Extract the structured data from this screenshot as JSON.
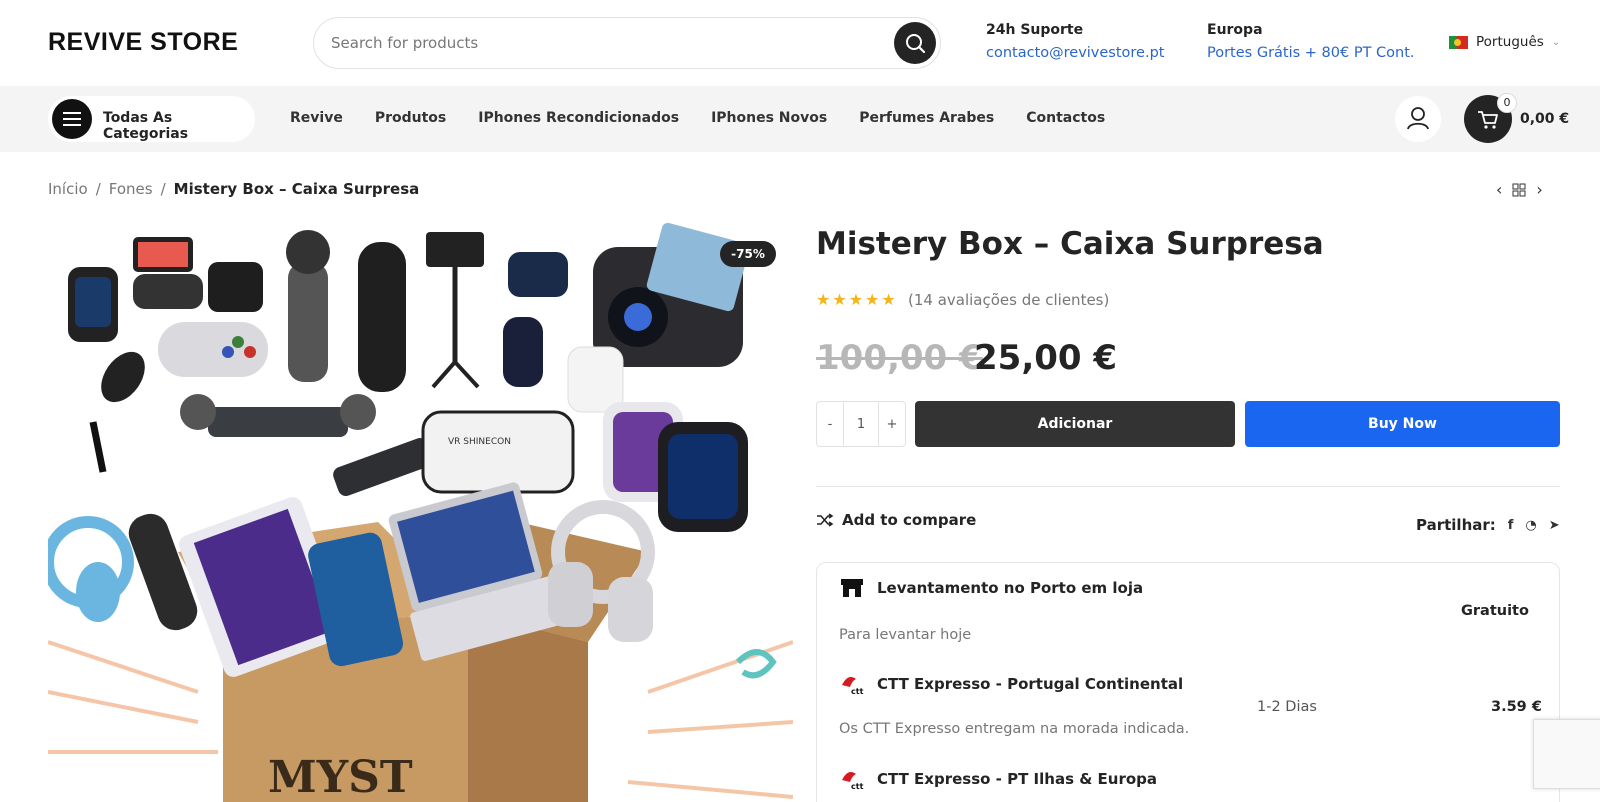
{
  "header": {
    "logo": "REVIVE STORE",
    "search_placeholder": "Search for products",
    "support": {
      "title": "24h Suporte",
      "email": "contacto@revivestore.pt"
    },
    "region": {
      "title": "Europa",
      "shipping": "Portes Grátis + 80€ PT Cont."
    },
    "language": "Português"
  },
  "nav": {
    "categories_label": "Todas As Categorias",
    "items": [
      "Revive",
      "Produtos",
      "IPhones Recondicionados",
      "IPhones Novos",
      "Perfumes Arabes",
      "Contactos"
    ],
    "cart_count": "0",
    "cart_total": "0,00 €"
  },
  "breadcrumb": [
    "Início",
    "Fones",
    "Mistery Box – Caixa Surpresa"
  ],
  "product": {
    "sale_badge": "-75%",
    "title": "Mistery Box – Caixa Surpresa",
    "rating": 5,
    "reviews": "(14 avaliações de clientes)",
    "old_price": "100,00 €",
    "price": "25,00 €",
    "qty_minus": "-",
    "qty_value": "1",
    "qty_plus": "+",
    "add_label": "Adicionar",
    "buy_now_label": "Buy Now",
    "compare_label": "Add to compare",
    "share_label": "Partilhar:",
    "share_icons": [
      "f",
      "◔",
      "➤"
    ]
  },
  "shipping": {
    "options": [
      {
        "name": "Levantamento no Porto em loja",
        "desc": "Para levantar hoje",
        "days": "",
        "price": "Gratuito"
      },
      {
        "name": "CTT Expresso - Portugal Continental",
        "desc": "Os CTT Expresso entregam na morada indicada.",
        "days": "1-2 Dias",
        "price": "3.59 €"
      },
      {
        "name": "CTT Expresso - PT Ilhas & Europa",
        "desc": "",
        "days": "",
        "price": ""
      }
    ],
    "ctt_logo_text": "ctt"
  },
  "image_text": {
    "box_letters": "MYST",
    "vr_brand": "VR SHINECON"
  },
  "colors": {
    "buy_now": "#1a66f0",
    "add": "#333333",
    "link": "#2a66c9",
    "star": "#f3b51a"
  }
}
